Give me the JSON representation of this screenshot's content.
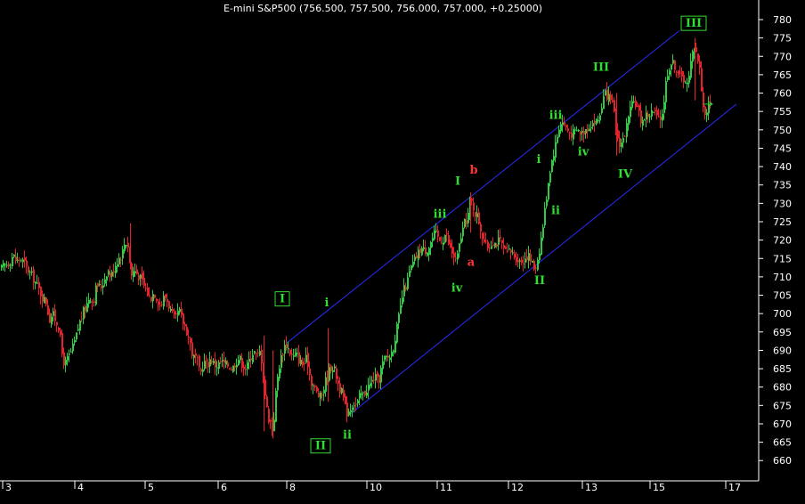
{
  "title": "E-mini S&P500 (756.500, 757.500, 756.000, 757.000, +0.25000)",
  "colors": {
    "background": "#000000",
    "up": "#2ecc40",
    "down": "#e8202a",
    "channel": "#2a2aff",
    "wave_green": "#33dd33",
    "wave_red": "#ff3333",
    "axis": "#ffffff"
  },
  "chart_data": {
    "type": "candlestick",
    "title": "E-mini S&P500 (756.500, 757.500, 756.000, 757.000, +0.25000)",
    "ylim": [
      655,
      785
    ],
    "y_ticks": [
      660,
      665,
      670,
      675,
      680,
      685,
      690,
      695,
      700,
      705,
      710,
      715,
      720,
      725,
      730,
      735,
      740,
      745,
      750,
      755,
      760,
      765,
      770,
      775,
      780
    ],
    "x_ticks": [
      "3",
      "4",
      "5",
      "6",
      "8",
      "10",
      "11",
      "12",
      "13",
      "15",
      "17"
    ],
    "grid": false,
    "last_price": 757.0,
    "close_path": [
      [
        0,
        712
      ],
      [
        4,
        713
      ],
      [
        10,
        714
      ],
      [
        14,
        716
      ],
      [
        18,
        714
      ],
      [
        22,
        715
      ],
      [
        26,
        714
      ],
      [
        30,
        712
      ],
      [
        36,
        710
      ],
      [
        40,
        708
      ],
      [
        44,
        706
      ],
      [
        48,
        704
      ],
      [
        52,
        703
      ],
      [
        54,
        698
      ],
      [
        58,
        700
      ],
      [
        62,
        698
      ],
      [
        66,
        696
      ],
      [
        68,
        690
      ],
      [
        72,
        686
      ],
      [
        76,
        688
      ],
      [
        80,
        690
      ],
      [
        84,
        693
      ],
      [
        88,
        697
      ],
      [
        92,
        700
      ],
      [
        96,
        702
      ],
      [
        100,
        705
      ],
      [
        104,
        703
      ],
      [
        108,
        708
      ],
      [
        112,
        707
      ],
      [
        116,
        709
      ],
      [
        120,
        712
      ],
      [
        124,
        710
      ],
      [
        128,
        713
      ],
      [
        132,
        715
      ],
      [
        136,
        716
      ],
      [
        140,
        720
      ],
      [
        144,
        718
      ],
      [
        146,
        710
      ],
      [
        150,
        712
      ],
      [
        156,
        710
      ],
      [
        160,
        708
      ],
      [
        164,
        706
      ],
      [
        168,
        704
      ],
      [
        172,
        706
      ],
      [
        176,
        704
      ],
      [
        180,
        702
      ],
      [
        184,
        705
      ],
      [
        188,
        703
      ],
      [
        192,
        700
      ],
      [
        196,
        698
      ],
      [
        200,
        701
      ],
      [
        204,
        698
      ],
      [
        208,
        696
      ],
      [
        212,
        693
      ],
      [
        216,
        688
      ],
      [
        220,
        688
      ],
      [
        224,
        683
      ],
      [
        228,
        687
      ],
      [
        232,
        686
      ],
      [
        236,
        688
      ],
      [
        240,
        686
      ],
      [
        244,
        686
      ],
      [
        248,
        687
      ],
      [
        252,
        686
      ],
      [
        256,
        686
      ],
      [
        260,
        685
      ],
      [
        264,
        687
      ],
      [
        268,
        688
      ],
      [
        272,
        686
      ],
      [
        276,
        685
      ],
      [
        280,
        688
      ],
      [
        284,
        690
      ],
      [
        288,
        688
      ],
      [
        292,
        690
      ],
      [
        296,
        680
      ],
      [
        300,
        672
      ],
      [
        304,
        670
      ],
      [
        306,
        668
      ],
      [
        308,
        676
      ],
      [
        312,
        685
      ],
      [
        316,
        689
      ],
      [
        320,
        692
      ],
      [
        324,
        690
      ],
      [
        328,
        688
      ],
      [
        332,
        689
      ],
      [
        336,
        687
      ],
      [
        340,
        686
      ],
      [
        344,
        688
      ],
      [
        348,
        682
      ],
      [
        352,
        680
      ],
      [
        356,
        678
      ],
      [
        360,
        677
      ],
      [
        364,
        681
      ],
      [
        368,
        684
      ],
      [
        372,
        686
      ],
      [
        376,
        684
      ],
      [
        380,
        680
      ],
      [
        384,
        678
      ],
      [
        388,
        673
      ],
      [
        392,
        674
      ],
      [
        396,
        676
      ],
      [
        400,
        675
      ],
      [
        404,
        678
      ],
      [
        408,
        678
      ],
      [
        412,
        680
      ],
      [
        416,
        681
      ],
      [
        420,
        683
      ],
      [
        424,
        681
      ],
      [
        428,
        686
      ],
      [
        432,
        688
      ],
      [
        436,
        688
      ],
      [
        440,
        690
      ],
      [
        444,
        695
      ],
      [
        448,
        700
      ],
      [
        452,
        706
      ],
      [
        456,
        708
      ],
      [
        460,
        712
      ],
      [
        464,
        714
      ],
      [
        468,
        716
      ],
      [
        472,
        718
      ],
      [
        476,
        717
      ],
      [
        480,
        718
      ],
      [
        484,
        720
      ],
      [
        488,
        722
      ],
      [
        492,
        720
      ],
      [
        496,
        720
      ],
      [
        500,
        722
      ],
      [
        504,
        718
      ],
      [
        508,
        716
      ],
      [
        512,
        714
      ],
      [
        516,
        720
      ],
      [
        520,
        724
      ],
      [
        524,
        726
      ],
      [
        528,
        731
      ],
      [
        532,
        728
      ],
      [
        536,
        726
      ],
      [
        540,
        722
      ],
      [
        544,
        719
      ],
      [
        548,
        718
      ],
      [
        552,
        720
      ],
      [
        556,
        719
      ],
      [
        560,
        720
      ],
      [
        564,
        718
      ],
      [
        568,
        716
      ],
      [
        572,
        717
      ],
      [
        576,
        716
      ],
      [
        580,
        715
      ],
      [
        584,
        714
      ],
      [
        588,
        715
      ],
      [
        592,
        716
      ],
      [
        596,
        714
      ],
      [
        600,
        712
      ],
      [
        604,
        716
      ],
      [
        608,
        722
      ],
      [
        612,
        730
      ],
      [
        616,
        738
      ],
      [
        620,
        743
      ],
      [
        624,
        747
      ],
      [
        628,
        752
      ],
      [
        632,
        752
      ],
      [
        636,
        750
      ],
      [
        640,
        749
      ],
      [
        644,
        749
      ],
      [
        648,
        750
      ],
      [
        652,
        749
      ],
      [
        656,
        750
      ],
      [
        660,
        751
      ],
      [
        664,
        752
      ],
      [
        668,
        752
      ],
      [
        672,
        753
      ],
      [
        676,
        758
      ],
      [
        680,
        760
      ],
      [
        684,
        758
      ],
      [
        688,
        756
      ],
      [
        692,
        748
      ],
      [
        696,
        746
      ],
      [
        700,
        748
      ],
      [
        704,
        752
      ],
      [
        708,
        756
      ],
      [
        712,
        758
      ],
      [
        716,
        755
      ],
      [
        720,
        752
      ],
      [
        724,
        754
      ],
      [
        728,
        754
      ],
      [
        732,
        755
      ],
      [
        736,
        754
      ],
      [
        740,
        752
      ],
      [
        744,
        756
      ],
      [
        748,
        765
      ],
      [
        752,
        768
      ],
      [
        756,
        768
      ],
      [
        760,
        766
      ],
      [
        764,
        764
      ],
      [
        768,
        764
      ],
      [
        772,
        762
      ],
      [
        776,
        770
      ],
      [
        780,
        774
      ],
      [
        782,
        770
      ],
      [
        786,
        765
      ],
      [
        788,
        758
      ],
      [
        790,
        754
      ],
      [
        794,
        756
      ],
      [
        797,
        757
      ]
    ],
    "channel_lines": [
      {
        "from": [
          322,
          692
        ],
        "to": [
          763,
          777
        ]
      },
      {
        "from": [
          390,
          672
        ],
        "to": [
          827,
          757
        ]
      }
    ],
    "annotations": [
      {
        "text": "I",
        "x": 317,
        "price": 704,
        "color": "green",
        "boxed": true
      },
      {
        "text": "i",
        "x": 367,
        "price": 703,
        "color": "green",
        "boxed": false
      },
      {
        "text": "II",
        "x": 360,
        "price": 664,
        "color": "green",
        "boxed": true
      },
      {
        "text": "ii",
        "x": 390,
        "price": 667,
        "color": "green",
        "boxed": false
      },
      {
        "text": "iii",
        "x": 494,
        "price": 727,
        "color": "green",
        "boxed": false
      },
      {
        "text": "iv",
        "x": 513,
        "price": 707,
        "color": "green",
        "boxed": false
      },
      {
        "text": "I",
        "x": 514,
        "price": 736,
        "color": "green",
        "boxed": false
      },
      {
        "text": "b",
        "x": 532,
        "price": 739,
        "color": "red",
        "boxed": false
      },
      {
        "text": "a",
        "x": 529,
        "price": 714,
        "color": "red",
        "boxed": false
      },
      {
        "text": "i",
        "x": 605,
        "price": 742,
        "color": "green",
        "boxed": false
      },
      {
        "text": "ii",
        "x": 624,
        "price": 728,
        "color": "green",
        "boxed": false
      },
      {
        "text": "II",
        "x": 606,
        "price": 709,
        "color": "green",
        "boxed": false
      },
      {
        "text": "iii",
        "x": 624,
        "price": 754,
        "color": "green",
        "boxed": false
      },
      {
        "text": "iv",
        "x": 655,
        "price": 744,
        "color": "green",
        "boxed": false
      },
      {
        "text": "III",
        "x": 675,
        "price": 767,
        "color": "green",
        "boxed": false
      },
      {
        "text": "IV",
        "x": 702,
        "price": 738,
        "color": "green",
        "boxed": false
      },
      {
        "text": "III",
        "x": 779,
        "price": 779,
        "color": "green",
        "boxed": true
      }
    ]
  }
}
